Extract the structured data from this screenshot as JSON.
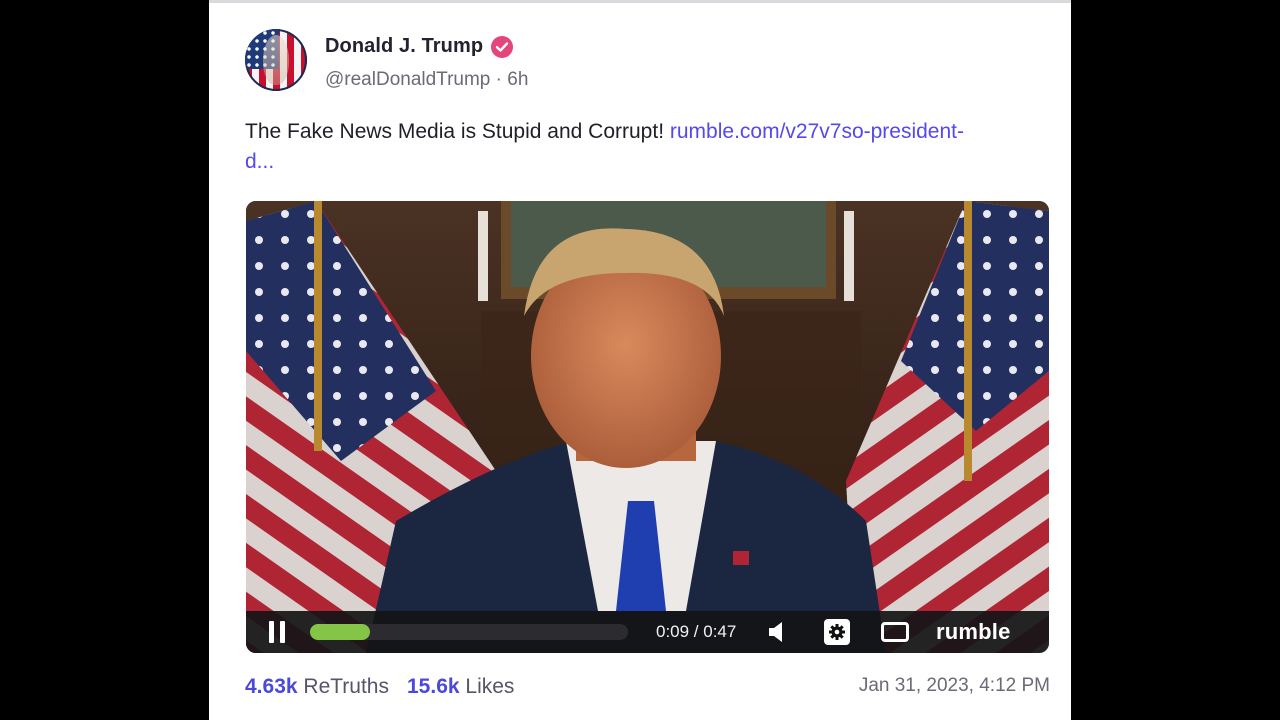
{
  "post": {
    "author_name": "Donald J. Trump",
    "handle": "@realDonaldTrump",
    "separator": "·",
    "age": "6h",
    "text": "The Fake News Media is Stupid and Corrupt! ",
    "link_text": "rumble.com/v27v7so-president-d...",
    "date": "Jan 31, 2023, 4:12 PM"
  },
  "video": {
    "current_time": "0:09",
    "duration": "0:47",
    "time_display": "0:09 / 0:47",
    "progress_fraction": 0.19,
    "brand": "rumble"
  },
  "stats": {
    "retruths_count": "4.63k",
    "retruths_label": "ReTruths",
    "likes_count": "15.6k",
    "likes_label": "Likes"
  },
  "icons": {
    "verified": "verified-check-icon",
    "pause": "pause-icon",
    "volume": "volume-icon",
    "settings": "gear-icon",
    "fullscreen": "fullscreen-icon"
  },
  "colors": {
    "link": "#5448ee",
    "verified_badge": "#e4457a",
    "progress_fill": "#84c548",
    "stat_count": "#4c48d8"
  }
}
